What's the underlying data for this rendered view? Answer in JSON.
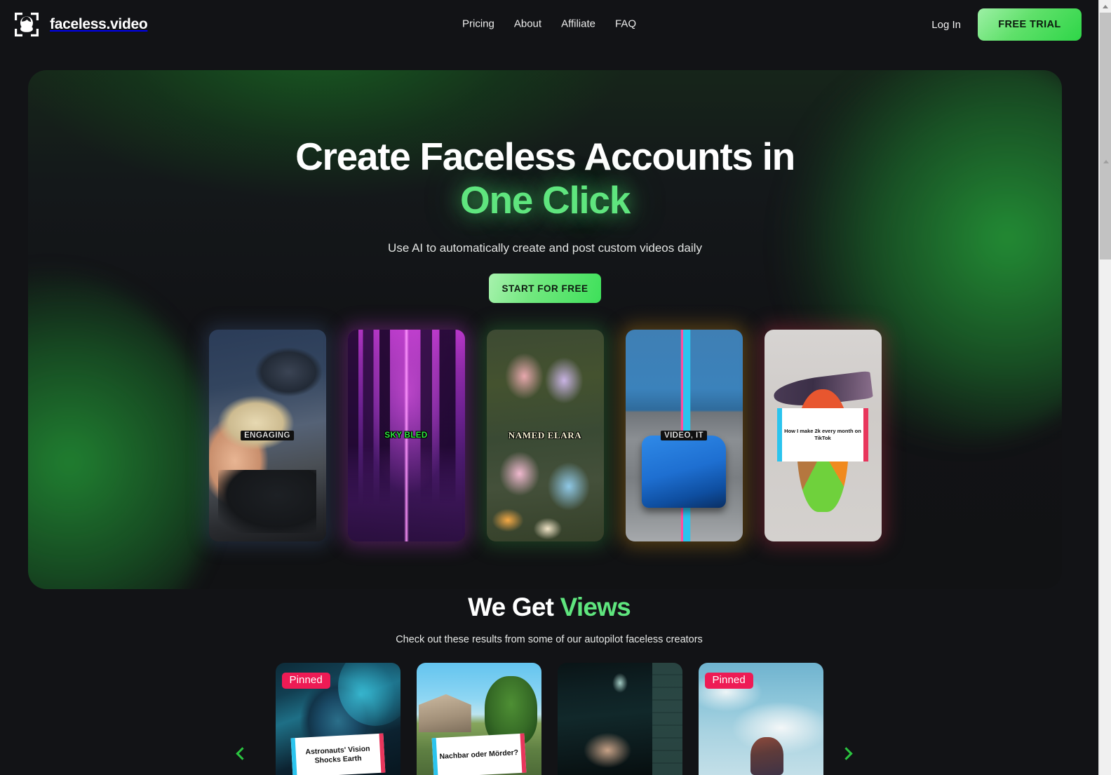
{
  "brand": {
    "name": "faceless.video",
    "icon": "face-scan-icon"
  },
  "nav": {
    "items": [
      {
        "label": "Pricing"
      },
      {
        "label": "About"
      },
      {
        "label": "Affiliate"
      },
      {
        "label": "FAQ"
      }
    ],
    "login_label": "Log In",
    "trial_label": "FREE TRIAL"
  },
  "hero": {
    "title_line1": "Create Faceless Accounts in",
    "title_line2": "One Click",
    "subtitle": "Use AI to automatically create and post custom videos daily",
    "cta_label": "START FOR FREE",
    "thumbs": [
      {
        "caption": "ENGAGING",
        "style": "cap-white",
        "art": "money-in-car"
      },
      {
        "caption": "SKY BLED",
        "style": "cap-green",
        "art": "cyberpunk-city"
      },
      {
        "caption": "NAMED ELARA",
        "style": "cap-serif",
        "art": "garden-fairies"
      },
      {
        "caption": "VIDEO, IT",
        "style": "cap-white",
        "art": "blue-sports-car"
      },
      {
        "caption": "How I make 2k every month on TikTok",
        "style": "notecard",
        "art": "clay-cutting"
      }
    ]
  },
  "views": {
    "title_plain": "We Get ",
    "title_accent": "Views",
    "subtitle": "Check out these results from some of our autopilot faceless creators",
    "prev_label": "Previous",
    "next_label": "Next",
    "cards": [
      {
        "pinned": true,
        "pinned_label": "Pinned",
        "note": "Astronauts' Vision Shocks Earth",
        "art": "earth-eye"
      },
      {
        "pinned": false,
        "pinned_label": "",
        "note": "Nachbar oder Mörder?",
        "art": "suburban-house"
      },
      {
        "pinned": false,
        "pinned_label": "",
        "note": "",
        "art": "man-in-elevator"
      },
      {
        "pinned": true,
        "pinned_label": "Pinned",
        "note": "",
        "art": "woman-in-clouds"
      }
    ]
  },
  "colors": {
    "background": "#121316",
    "accent_green": "#5fe57e",
    "button_green": "#3ee05a",
    "pinned_pink": "#ee1b55",
    "arrow_green": "#2bc540"
  }
}
